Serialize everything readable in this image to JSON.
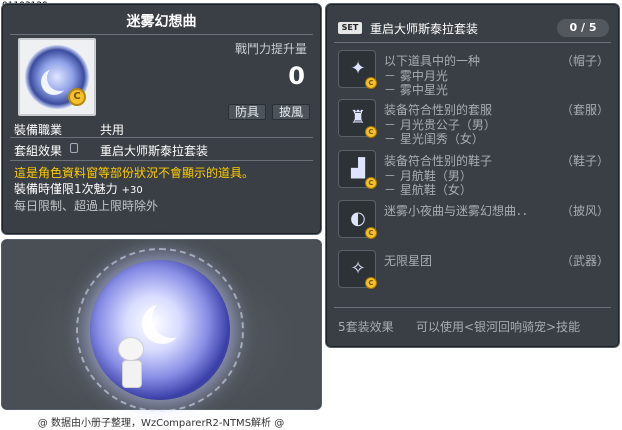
{
  "item_id": "01103129",
  "item": {
    "title": "迷雾幻想曲",
    "power_label": "戰鬥力提升量",
    "power_value": "0",
    "tags": [
      "防具",
      "披風"
    ],
    "job_label": "裝備職業",
    "job_value": "共用",
    "set_label": "套組效果",
    "set_value": "重启大师斯泰拉套装",
    "warning": "這是角色資料窗等部份狀況不會顯示的道具。",
    "charm_text": "裝備時僅限1次魅力",
    "charm_value": "+30",
    "limit_text": "每日限制、超過上限時除外"
  },
  "credit": "@ 数据由小册子整理，WzComparerR2-NTMS解析 @",
  "set": {
    "badge": "SET",
    "title": "重启大师斯泰拉套装",
    "count": "0 / 5",
    "items": [
      {
        "name": "以下道具中的一种",
        "type": "（帽子）",
        "subs": [
          "－ 雾中月光",
          "－ 雾中星光"
        ],
        "icon": "hat-icon"
      },
      {
        "name": "装备符合性别的套服",
        "type": "（套服）",
        "subs": [
          "－ 月光贵公子（男）",
          "－ 星光闺秀（女）"
        ],
        "icon": "suit-icon"
      },
      {
        "name": "装备符合性别的鞋子",
        "type": "（鞋子）",
        "subs": [
          "－ 月航鞋（男）",
          "－ 星航鞋（女）"
        ],
        "icon": "shoes-icon"
      },
      {
        "name": "迷雾小夜曲与迷雾幻想曲．．",
        "type": "（披风）",
        "subs": [],
        "icon": "cape-icon"
      },
      {
        "name": "无限星团",
        "type": "（武器）",
        "subs": [],
        "icon": "weapon-icon"
      }
    ],
    "bonus_label": "5套装效果",
    "bonus_value": "可以使用<银河回响骑宠>技能"
  }
}
